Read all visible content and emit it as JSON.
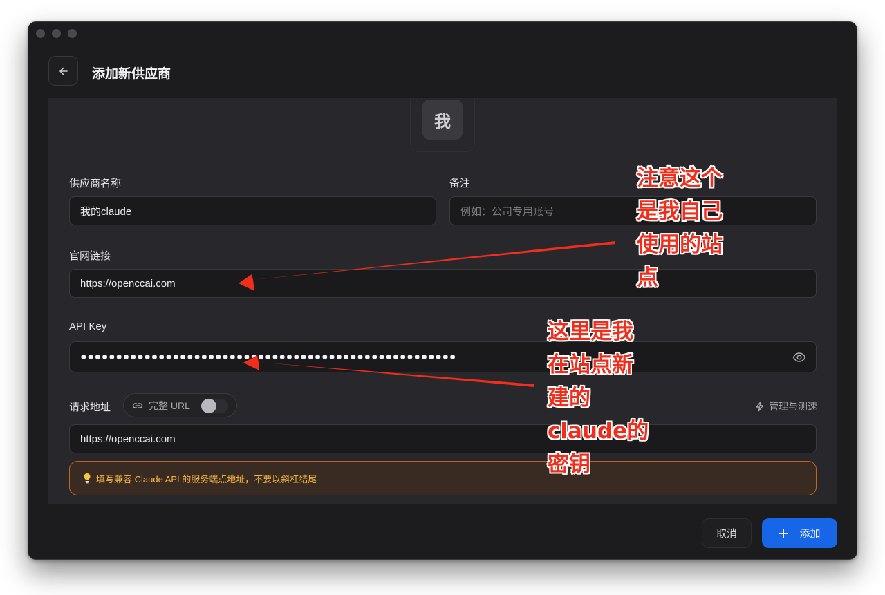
{
  "header": {
    "title": "添加新供应商"
  },
  "avatar": {
    "char": "我"
  },
  "form": {
    "name": {
      "label": "供应商名称",
      "value": "我的claude"
    },
    "note": {
      "label": "备注",
      "placeholder": "例如：公司专用账号"
    },
    "website": {
      "label": "官网链接",
      "value": "https://openccai.com"
    },
    "api_key": {
      "label": "API Key",
      "value": "●●●●●●●●●●●●●●●●●●●●●●●●●●●●●●●●●●●●●●●●●●●●●●●●●●●●●"
    },
    "endpoint": {
      "label": "请求地址",
      "full_url_toggle": "完整 URL",
      "full_url_enabled": false,
      "manage_label": "管理与测速",
      "value": "https://openccai.com"
    },
    "hint": "填写兼容 Claude API 的服务端点地址，不要以斜杠结尾"
  },
  "footer": {
    "cancel_label": "取消",
    "add_label": "添加"
  },
  "annotations": {
    "note1": "注意这个\n是我自己\n使用的站\n点",
    "note2": "这里是我\n在站点新\n建的\nclaude的\n密钥"
  },
  "colors": {
    "accent": "#1766e8",
    "hint_text": "#f5b544",
    "hint_border": "#c0661e",
    "annotation": "#f12d1c"
  }
}
